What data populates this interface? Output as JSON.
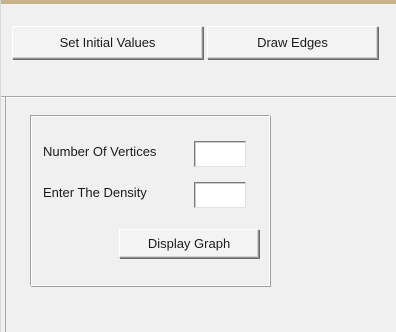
{
  "toolbar": {
    "set_initial_values_label": "Set Initial Values",
    "draw_edges_label": "Draw Edges"
  },
  "form": {
    "vertices_label": "Number Of  Vertices",
    "vertices_value": "",
    "density_label": "Enter The Density",
    "density_value": "",
    "display_graph_label": "Display Graph"
  },
  "colors": {
    "window_background": "#f0f0f0",
    "title_rule": "#c7b48a",
    "textbox_background": "#ffffff"
  }
}
